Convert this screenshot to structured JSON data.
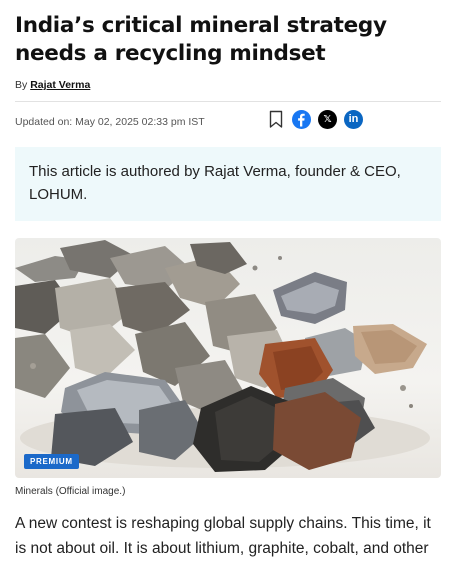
{
  "article": {
    "headline": "India’s critical mineral strategy needs a recycling mindset",
    "byline_prefix": "By",
    "author": "Rajat Verma",
    "updated": "Updated on: May 02, 2025 02:33 pm IST",
    "callout": "This article is authored by Rajat Verma, founder & CEO, LOHUM.",
    "badge": "PREMIUM",
    "caption": "Minerals (Official image.)",
    "body": "A new contest is reshaping global supply chains. This time, it is not about oil. It is about lithium, graphite, cobalt, and other"
  },
  "share": {
    "icons": [
      "bookmark-icon",
      "facebook-icon",
      "x-icon",
      "linkedin-icon"
    ],
    "x_glyph": "𝕏",
    "linkedin_glyph": "in"
  },
  "colors": {
    "facebook": "#1877f2",
    "x": "#000000",
    "linkedin": "#0a66c2",
    "badge": "#1b69c9",
    "callout_bg": "#eef9fb"
  }
}
